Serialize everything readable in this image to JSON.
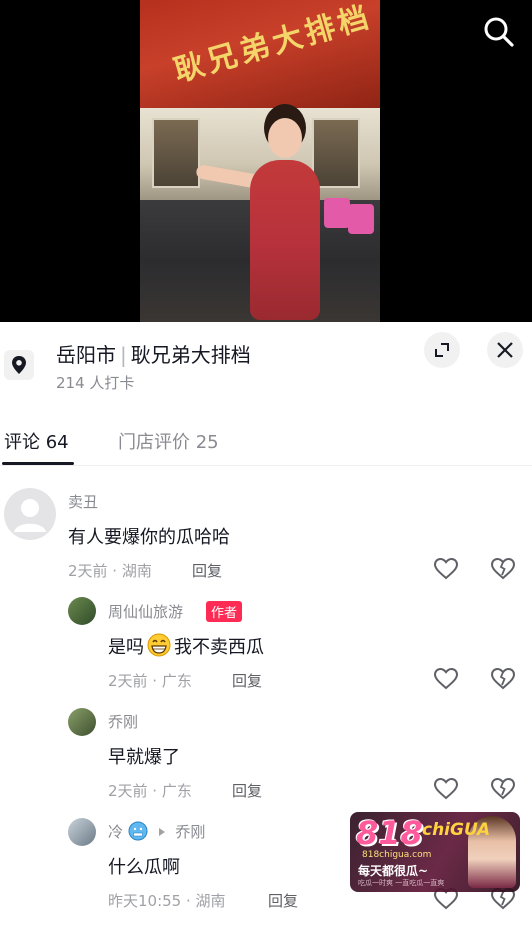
{
  "video": {
    "sign_text": "耿兄弟大排档"
  },
  "location": {
    "city": "岳阳市",
    "place": "耿兄弟大排档",
    "checkins": "214 人打卡"
  },
  "tabs": [
    {
      "label": "评论 64"
    },
    {
      "label": "门店评价 25"
    }
  ],
  "comments": [
    {
      "author": "卖丑",
      "text": "有人要爆你的瓜哈哈",
      "time": "2天前 · 湖南",
      "reply": "回复"
    },
    {
      "author": "周仙仙旅游",
      "badge": "作者",
      "text_a": "是吗",
      "text_b": "我不卖西瓜",
      "time": "2天前 · 广东",
      "reply": "回复"
    },
    {
      "author": "乔刚",
      "text": "早就爆了",
      "time": "2天前 · 广东",
      "reply": "回复"
    },
    {
      "author": "冷",
      "reply_to": "乔刚",
      "text": "什么瓜啊",
      "time": "昨天10:55 · 湖南",
      "reply": "回复"
    }
  ],
  "watermark": {
    "number": "818",
    "word": "chiGUA",
    "url": "818chigua.com",
    "slogan": "每天都很瓜~",
    "small": "吃瓜一时爽 一直吃瓜一直爽"
  },
  "icons": {
    "search": "search-icon",
    "pin": "map-pin-icon",
    "expand": "expand-icon",
    "close": "close-icon",
    "like": "heart-outline-icon",
    "dislike": "broken-heart-icon",
    "grin": "grin-emoji-icon",
    "cold": "cold-face-emoji-icon",
    "reply_arrow": "triangle-right-icon"
  },
  "colors": {
    "author_badge": "#fe2c55",
    "text_primary": "#161823",
    "text_secondary": "#8a8b91"
  }
}
